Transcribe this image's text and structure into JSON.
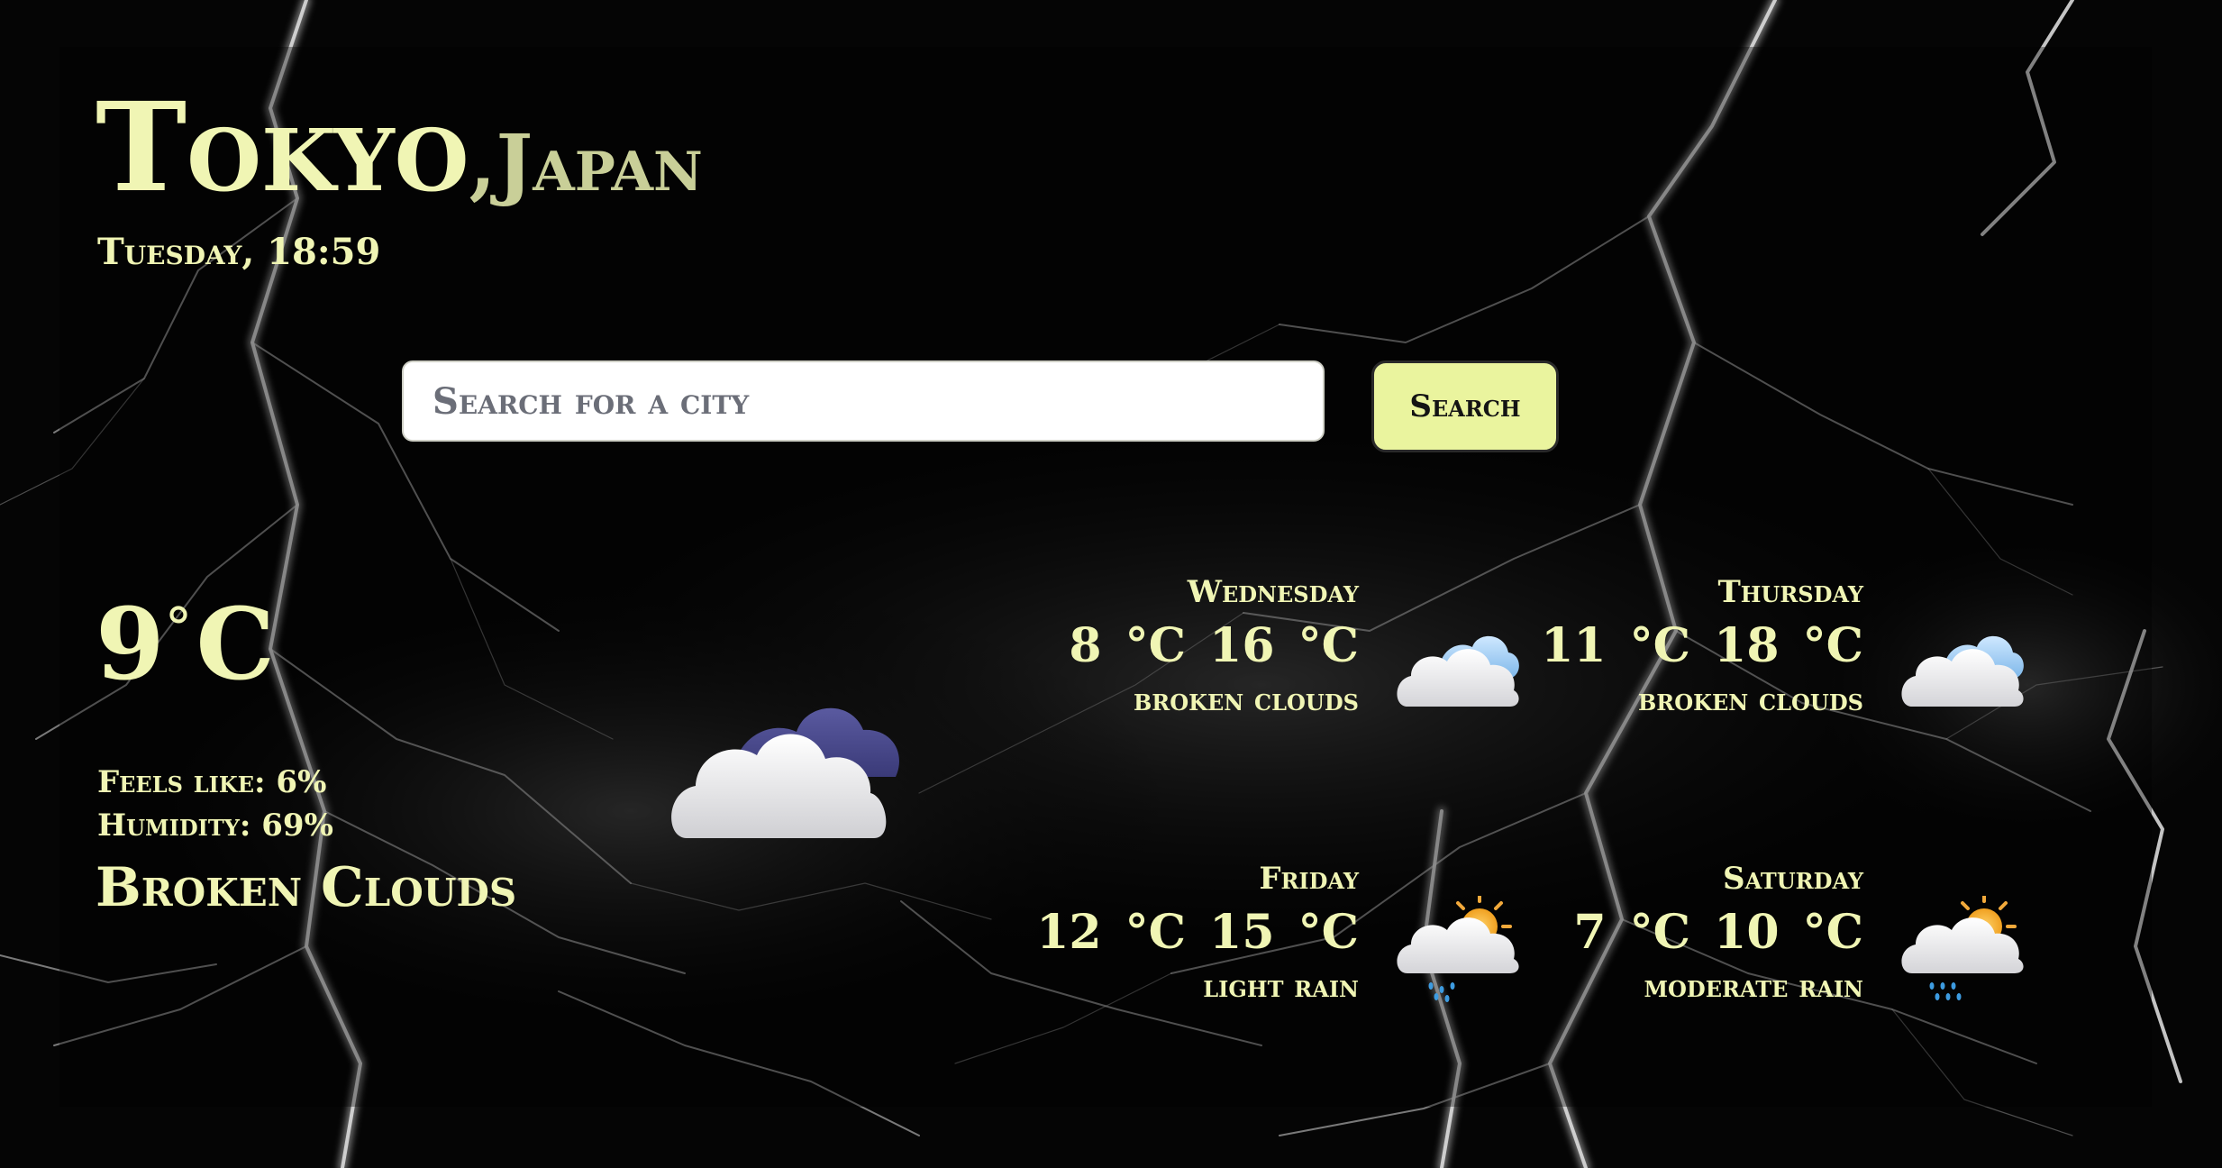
{
  "location": {
    "city": "Tokyo",
    "country": "Japan"
  },
  "date": "Tuesday, 18:59",
  "search": {
    "placeholder": "Search for a city",
    "button_label": "Search"
  },
  "current": {
    "temperature": "9",
    "unit": "C",
    "feels_like": "Feels like: 6%",
    "humidity": "Humidity: 69%",
    "condition": "Broken Clouds",
    "icon": "broken-clouds-icon"
  },
  "forecast": [
    {
      "day": "Wednesday",
      "temps": "8 °C 16 °C",
      "desc": "broken clouds",
      "icon": "broken-clouds-icon"
    },
    {
      "day": "Thursday",
      "temps": "11 °C 18 °C",
      "desc": "broken clouds",
      "icon": "broken-clouds-icon"
    },
    {
      "day": "Friday",
      "temps": "12 °C 15 °C",
      "desc": "light rain",
      "icon": "light-rain-icon"
    },
    {
      "day": "Saturday",
      "temps": "7 °C 10 °C",
      "desc": "moderate rain",
      "icon": "moderate-rain-icon"
    }
  ],
  "colors": {
    "accent_text": "#f0f5b4",
    "button_bg": "#eaf49e",
    "background": "#050505"
  }
}
